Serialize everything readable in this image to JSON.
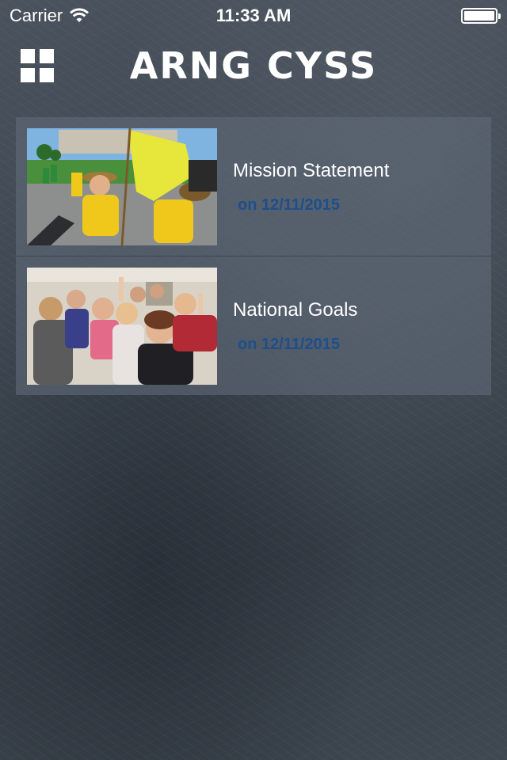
{
  "status_bar": {
    "carrier": "Carrier",
    "time": "11:33 AM",
    "wifi_icon": "wifi-icon",
    "battery_level": 1.0
  },
  "header": {
    "menu_icon": "grid-menu-icon",
    "title": "ARNG CYSS"
  },
  "items": [
    {
      "title": "Mission Statement",
      "date": "on 12/11/2015",
      "image": "photo of youth in yellow shirts holding a flag"
    },
    {
      "title": "National Goals",
      "date": "on 12/11/2015",
      "image": "group photo of young people flexing arms"
    }
  ],
  "colors": {
    "date_text": "#1c4f8c",
    "item_background": "#5f6978"
  }
}
